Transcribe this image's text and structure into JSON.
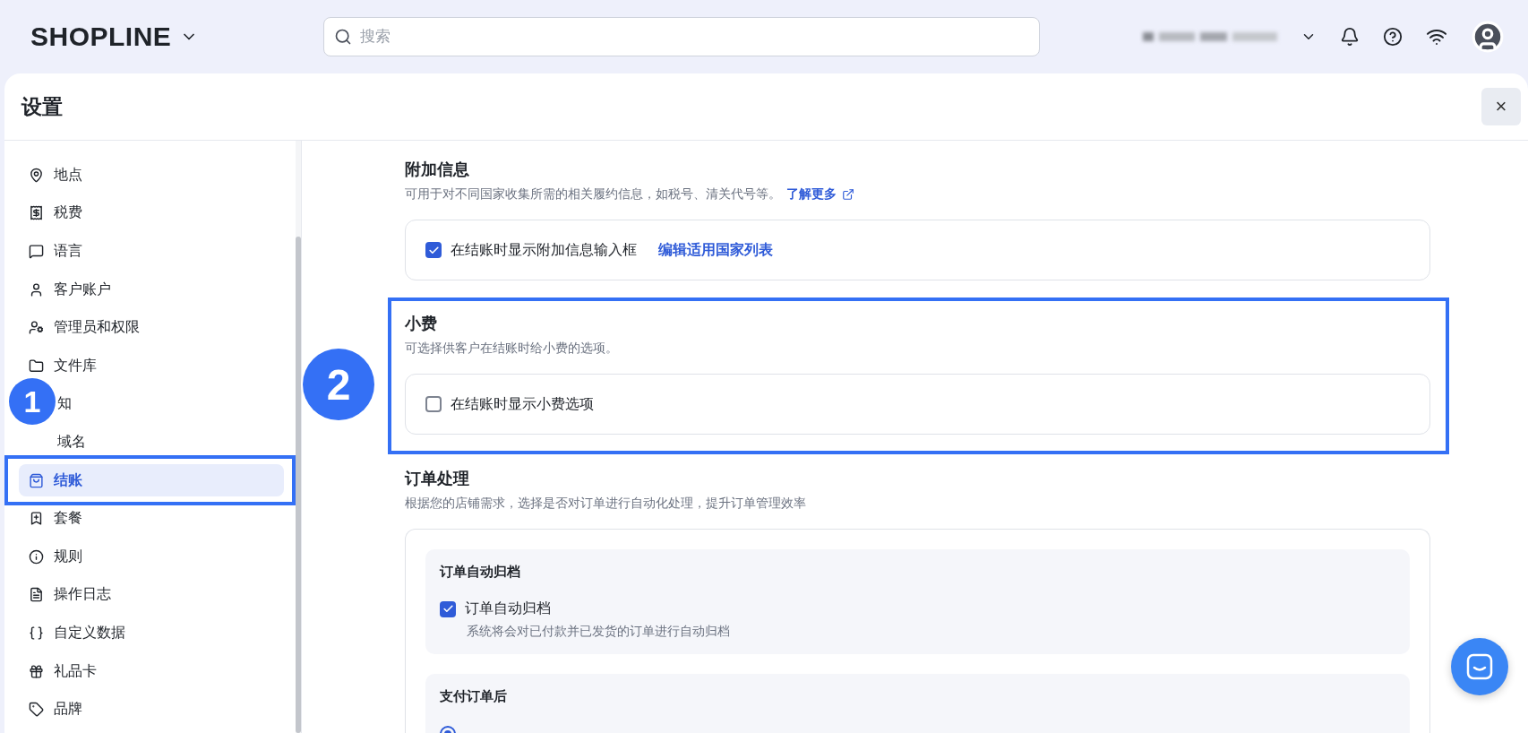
{
  "top_bar": {
    "logo": "SHOPLINE",
    "search": {
      "placeholder": "搜索"
    }
  },
  "panel": {
    "title": "设置",
    "close": "×"
  },
  "sidebar": {
    "badge": "1",
    "items": [
      {
        "label": "地点",
        "selected": false
      },
      {
        "label": "税费",
        "selected": false
      },
      {
        "label": "语言",
        "selected": false
      },
      {
        "label": "客户账户",
        "selected": false
      },
      {
        "label": "管理员和权限",
        "selected": false
      },
      {
        "label": "文件库",
        "selected": false
      },
      {
        "label": "知",
        "selected": false,
        "covered": true
      },
      {
        "label": "域名",
        "selected": false,
        "covered": true
      },
      {
        "label": "结账",
        "selected": true,
        "highlighted": true
      },
      {
        "label": "套餐",
        "selected": false
      },
      {
        "label": "规则",
        "selected": false
      },
      {
        "label": "操作日志",
        "selected": false
      },
      {
        "label": "自定义数据",
        "selected": false
      },
      {
        "label": "礼品卡",
        "selected": false
      },
      {
        "label": "品牌",
        "selected": false
      }
    ]
  },
  "sections": [
    {
      "title": "附加信息",
      "description": "可用于对不同国家收集所需的相关履约信息，如税号、清关代号等。",
      "link": "了解更多",
      "highlighted": false,
      "option": {
        "label": "在结账时显示附加信息输入框",
        "checked": true,
        "link": "编辑适用国家列表"
      }
    },
    {
      "title": "小费",
      "description": "可选择供客户在结账时给小费的选项。",
      "highlighted": true,
      "badge": "2",
      "option": {
        "label": "在结账时显示小费选项",
        "checked": false
      }
    }
  ],
  "order_processing": {
    "title": "订单处理",
    "description": "根据您的店铺需求，选择是否对订单进行自动化处理，提升订单管理效率",
    "groups": [
      {
        "title": "订单自动归档",
        "option": {
          "label": "订单自动归档",
          "checked": true,
          "hint": "系统将会对已付款并已发货的订单进行自动归档"
        }
      },
      {
        "title": "支付订单后",
        "radio": {
          "selected": true
        }
      }
    ]
  }
}
